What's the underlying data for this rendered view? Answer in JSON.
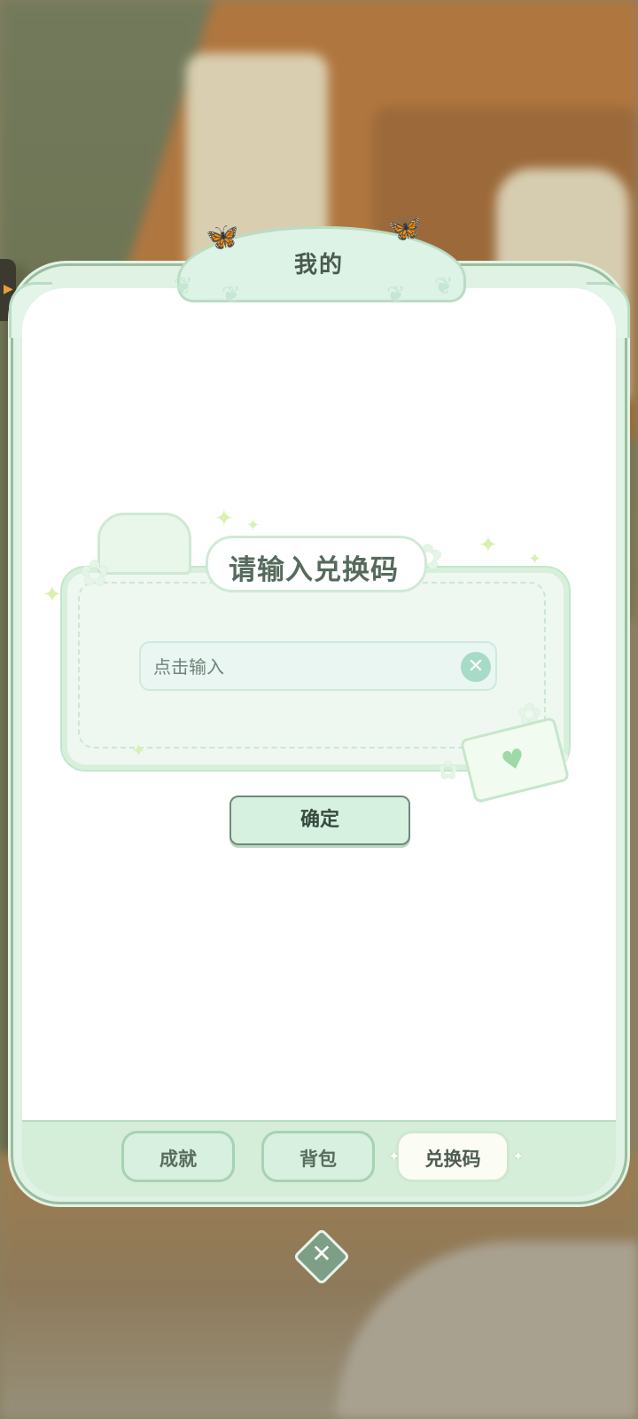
{
  "panel": {
    "title": "我的"
  },
  "redeem": {
    "heading": "请输入兑换码",
    "input_placeholder": "点击输入",
    "input_value": "",
    "confirm_label": "确定"
  },
  "tabs": [
    {
      "label": "成就",
      "active": false
    },
    {
      "label": "背包",
      "active": false
    },
    {
      "label": "兑换码",
      "active": true
    }
  ],
  "icons": {
    "clear": "close-circle-icon",
    "close": "close-icon",
    "side_handle": "chevron-right-icon"
  },
  "colors": {
    "accent": "#a7dbc7",
    "panel_bg": "#ffffff",
    "frame": "#d4eed9",
    "text_dark": "#364a3e"
  }
}
